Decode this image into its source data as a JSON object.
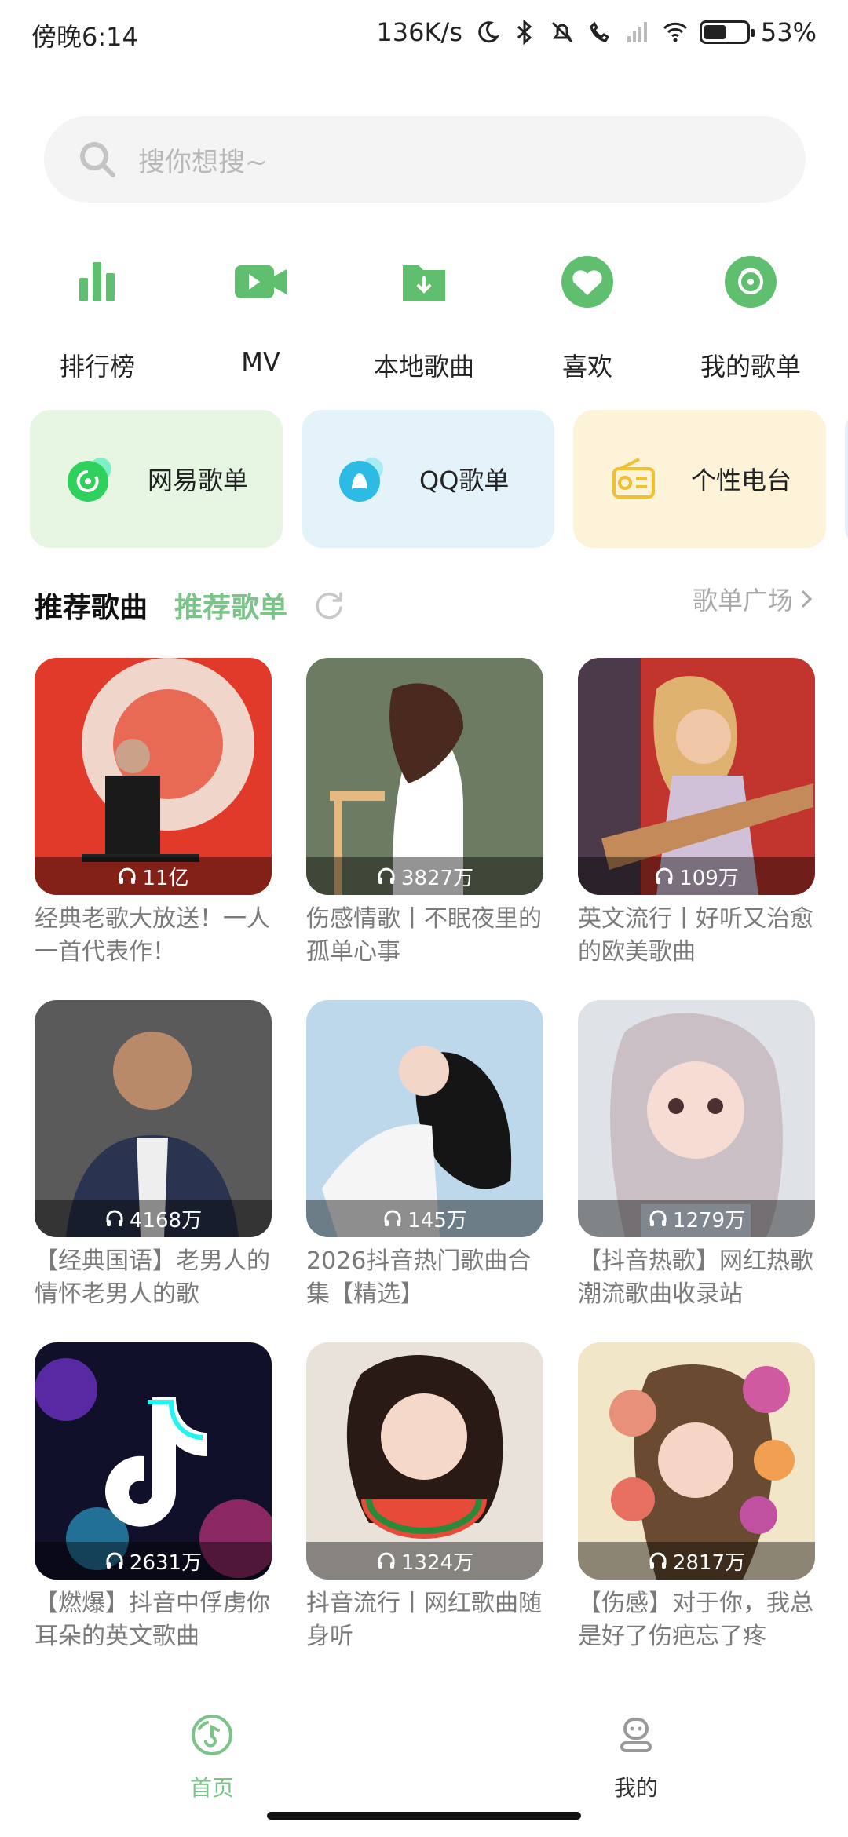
{
  "status_bar": {
    "time": "傍晚6:14",
    "network_speed": "136K/s",
    "battery_percent": "53%",
    "battery_level": 0.53
  },
  "search": {
    "placeholder": "搜你想搜~"
  },
  "quick_entries": [
    {
      "label": "排行榜",
      "icon": "bar-chart-icon"
    },
    {
      "label": "MV",
      "icon": "video-icon"
    },
    {
      "label": "本地歌曲",
      "icon": "download-folder-icon"
    },
    {
      "label": "喜欢",
      "icon": "heart-icon"
    },
    {
      "label": "我的歌单",
      "icon": "disc-icon"
    }
  ],
  "source_cards": [
    {
      "label": "网易歌单",
      "icon": "netease-icon",
      "bg": "#e6f6e3"
    },
    {
      "label": "QQ歌单",
      "icon": "qq-icon",
      "bg": "#e3f3f9"
    },
    {
      "label": "个性电台",
      "icon": "radio-icon",
      "bg": "#fdf3d9"
    }
  ],
  "section": {
    "tab_songs": "推荐歌曲",
    "tab_playlists": "推荐歌单",
    "plaza_link": "歌单广场"
  },
  "playlists": [
    {
      "count": "11亿",
      "title": "经典老歌大放送！一人一首代表作！"
    },
    {
      "count": "3827万",
      "title": "伤感情歌丨不眠夜里的孤单心事"
    },
    {
      "count": "109万",
      "title": "英文流行丨好听又治愈的欧美歌曲"
    },
    {
      "count": "4168万",
      "title": "【经典国语】老男人的情怀老男人的歌"
    },
    {
      "count": "145万",
      "title": "2026抖音热门歌曲合集【精选】"
    },
    {
      "count": "1279万",
      "title": "【抖音热歌】网红热歌潮流歌曲收录站"
    },
    {
      "count": "2631万",
      "title": "【燃爆】抖音中俘虏你耳朵的英文歌曲"
    },
    {
      "count": "1324万",
      "title": "抖音流行丨网红歌曲随身听"
    },
    {
      "count": "2817万",
      "title": "【伤感】对于你，我总是好了伤疤忘了疼"
    }
  ],
  "bottom_nav": [
    {
      "label": "首页",
      "icon": "home-music-icon",
      "active": true
    },
    {
      "label": "我的",
      "icon": "profile-icon",
      "active": false
    }
  ],
  "colors": {
    "accent": "#7cc38a",
    "icon_green": "#5fbf6e",
    "text_secondary": "#7a7a7a"
  }
}
